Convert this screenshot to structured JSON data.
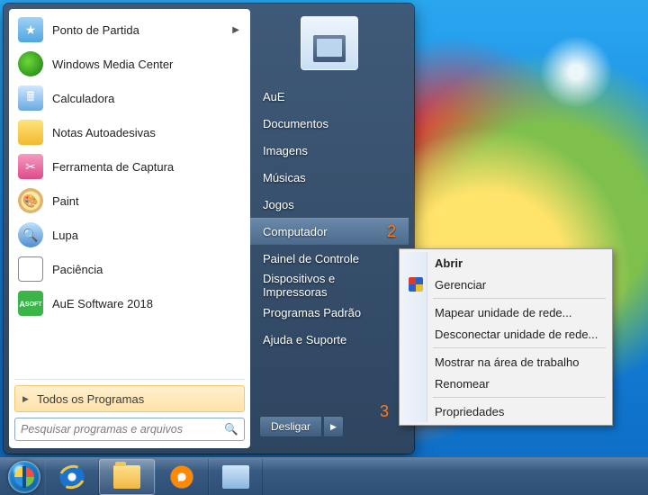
{
  "annotations": {
    "computador_badge": "2",
    "propriedades_badge": "3"
  },
  "left_programs": [
    {
      "label": "Ponto de Partida",
      "has_submenu": true
    },
    {
      "label": "Windows Media Center"
    },
    {
      "label": "Calculadora"
    },
    {
      "label": "Notas Autoadesivas"
    },
    {
      "label": "Ferramenta de Captura"
    },
    {
      "label": "Paint"
    },
    {
      "label": "Lupa"
    },
    {
      "label": "Paciência"
    },
    {
      "label": "AuE Software 2018"
    }
  ],
  "all_programs_label": "Todos os Programas",
  "search_placeholder": "Pesquisar programas e arquivos",
  "right_items": [
    {
      "label": "AuE"
    },
    {
      "label": "Documentos"
    },
    {
      "label": "Imagens"
    },
    {
      "label": "Músicas"
    },
    {
      "label": "Jogos"
    },
    {
      "label": "Computador",
      "highlight": true,
      "badge": "2"
    },
    {
      "label": "Painel de Controle"
    },
    {
      "label": "Dispositivos e Impressoras"
    },
    {
      "label": "Programas Padrão"
    },
    {
      "label": "Ajuda e Suporte"
    }
  ],
  "shutdown_label": "Desligar",
  "context_menu": {
    "items": [
      {
        "label": "Abrir",
        "bold": true
      },
      {
        "label": "Gerenciar",
        "shield": true
      },
      {
        "sep": true
      },
      {
        "label": "Mapear unidade de rede..."
      },
      {
        "label": "Desconectar unidade de rede..."
      },
      {
        "sep": true
      },
      {
        "label": "Mostrar na área de trabalho"
      },
      {
        "label": "Renomear"
      },
      {
        "sep": true
      },
      {
        "label": "Propriedades",
        "badge3": true
      }
    ]
  },
  "taskbar": {
    "items": [
      "internet-explorer",
      "file-explorer",
      "windows-media-player",
      "window"
    ]
  }
}
